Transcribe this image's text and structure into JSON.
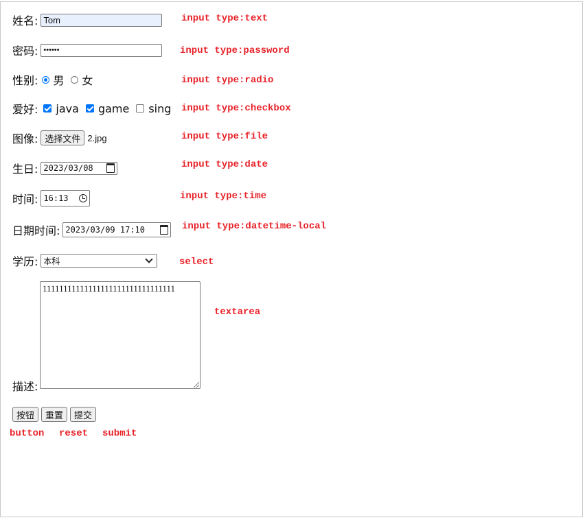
{
  "form": {
    "name": {
      "label": "姓名:",
      "value": "Tom",
      "note": "input type:text"
    },
    "password": {
      "label": "密码:",
      "value": "••••••",
      "note": "input type:password"
    },
    "gender": {
      "label": "性别:",
      "options": [
        "男",
        "女"
      ],
      "selected": "男",
      "note": "input type:radio"
    },
    "hobby": {
      "label": "爱好:",
      "options": [
        "java",
        "game",
        "sing"
      ],
      "checked": [
        "java",
        "game"
      ],
      "note": "input type:checkbox"
    },
    "image": {
      "label": "图像:",
      "button_label": "选择文件",
      "filename": "2.jpg",
      "note": "input type:file"
    },
    "birthday": {
      "label": "生日:",
      "value": "2023/03/08",
      "icon": "calendar-icon",
      "note": "input type:date"
    },
    "time": {
      "label": "时间:",
      "value": "16:13",
      "icon": "clock-icon",
      "note": "input type:time"
    },
    "datetime": {
      "label": "日期时间:",
      "value": "2023/03/09 17:10",
      "icon": "calendar-icon",
      "note": "input type:datetime-local"
    },
    "education": {
      "label": "学历:",
      "selected": "本科",
      "icon": "chevron-down-icon",
      "note": "select"
    },
    "description": {
      "label": "描述:",
      "value": "11111111111111111111111111111111",
      "note": "textarea"
    }
  },
  "buttons": {
    "button_label": "按钮",
    "reset_label": "重置",
    "submit_label": "提交",
    "notes": {
      "button": "button",
      "reset": "reset",
      "submit": "submit"
    }
  },
  "colors": {
    "note_red": "#e8232a",
    "accent_blue": "#0075ff",
    "autofill_bg": "#e8f0fe"
  }
}
